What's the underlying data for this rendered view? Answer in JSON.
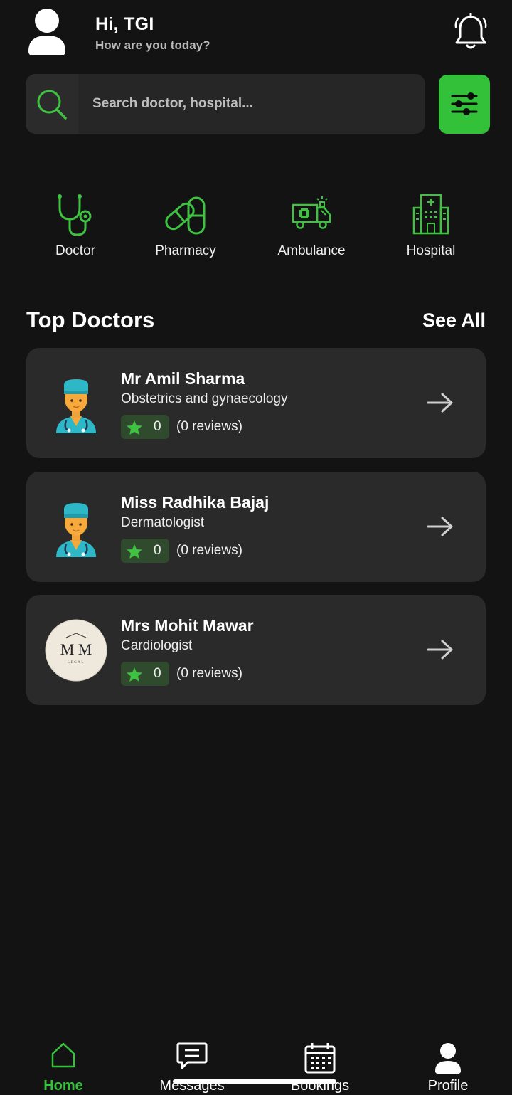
{
  "header": {
    "greeting": "Hi, TGI",
    "subgreeting": "How are you today?",
    "avatar_icon": "user-avatar-icon",
    "bell_icon": "bell-icon"
  },
  "search": {
    "placeholder": "Search doctor, hospital...",
    "icon": "search-icon",
    "filter_icon": "sliders-icon"
  },
  "categories": [
    {
      "label": "Doctor",
      "icon": "stethoscope-icon"
    },
    {
      "label": "Pharmacy",
      "icon": "pill-icon"
    },
    {
      "label": "Ambulance",
      "icon": "ambulance-icon"
    },
    {
      "label": "Hospital",
      "icon": "hospital-icon"
    }
  ],
  "top_doctors": {
    "title": "Top Doctors",
    "see_all": "See All",
    "doctors": [
      {
        "name": "Mr Amil Sharma",
        "specialty": "Obstetrics and gynaecology",
        "rating": "0",
        "reviews": "(0 reviews)",
        "photo": "doctor-avatar-icon"
      },
      {
        "name": "Miss Radhika Bajaj",
        "specialty": "Dermatologist",
        "rating": "0",
        "reviews": "(0 reviews)",
        "photo": "doctor-avatar-icon"
      },
      {
        "name": "Mrs Mohit Mawar",
        "specialty": "Cardiologist",
        "rating": "0",
        "reviews": "(0 reviews)",
        "photo": "monogram-logo"
      }
    ]
  },
  "logo_text": {
    "monogram": "M M",
    "sub": "LEGAL"
  },
  "nav": [
    {
      "label": "Home",
      "icon": "home-icon",
      "active": true
    },
    {
      "label": "Messages",
      "icon": "message-icon",
      "active": false
    },
    {
      "label": "Bookings",
      "icon": "calendar-icon",
      "active": false
    },
    {
      "label": "Profile",
      "icon": "profile-icon",
      "active": false
    }
  ],
  "colors": {
    "background": "#131313",
    "card": "#2a2a2a",
    "accent": "#33c13a",
    "rating_bg": "#2f4a2c"
  }
}
